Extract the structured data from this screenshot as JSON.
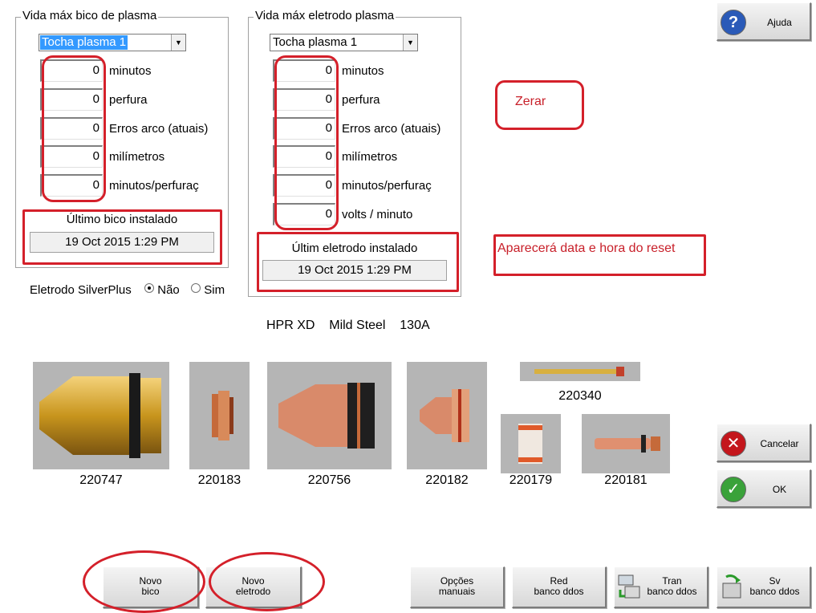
{
  "nozzle_panel": {
    "title": "Vida máx bico de plasma",
    "torch_select": "Tocha plasma 1",
    "fields": [
      {
        "value": "0",
        "label": "minutos"
      },
      {
        "value": "0",
        "label": "perfura"
      },
      {
        "value": "0",
        "label": "Erros arco (atuais)"
      },
      {
        "value": "0",
        "label": "milímetros"
      },
      {
        "value": "0",
        "label": "minutos/perfuraç"
      }
    ],
    "last_installed_label": "Último bico instalado",
    "last_installed_date": "19 Oct 2015  1:29 PM"
  },
  "electrode_panel": {
    "title": "Vida máx eletrodo plasma",
    "torch_select": "Tocha plasma 1",
    "fields": [
      {
        "value": "0",
        "label": "minutos"
      },
      {
        "value": "0",
        "label": "perfura"
      },
      {
        "value": "0",
        "label": "Erros arco (atuais)"
      },
      {
        "value": "0",
        "label": "milímetros"
      },
      {
        "value": "0",
        "label": "minutos/perfuraç"
      },
      {
        "value": "0",
        "label": "volts / minuto"
      }
    ],
    "last_installed_label": "Últim eletrodo instalado",
    "last_installed_date": "19 Oct 2015  1:29 PM"
  },
  "silverplus": {
    "label": "Eletrodo SilverPlus",
    "option_no": "Não",
    "option_yes": "Sim",
    "selected": "Não"
  },
  "annotations": {
    "reset": "Zerar",
    "reset_date": "Aparecerá data e hora do reset",
    "color": "#d4202a"
  },
  "process_info": "HPR XD    Mild Steel    130A",
  "parts": [
    {
      "id": "220747",
      "icon": "shield-cap"
    },
    {
      "id": "220183",
      "icon": "shield"
    },
    {
      "id": "220756",
      "icon": "retaining-cap"
    },
    {
      "id": "220182",
      "icon": "nozzle"
    },
    {
      "id": "220340",
      "icon": "water-tube"
    },
    {
      "id": "220179",
      "icon": "swirl-ring"
    },
    {
      "id": "220181",
      "icon": "electrode"
    }
  ],
  "buttons": {
    "help": "Ajuda",
    "cancel": "Cancelar",
    "ok": "OK",
    "new_nozzle_l1": "Novo",
    "new_nozzle_l2": "bico",
    "new_electrode_l1": "Novo",
    "new_electrode_l2": "eletrodo",
    "manual_l1": "Opções",
    "manual_l2": "manuais",
    "red_l1": "Red",
    "red_l2": "banco ddos",
    "tran_l1": "Tran",
    "tran_l2": "banco ddos",
    "sv_l1": "Sv",
    "sv_l2": "banco ddos"
  }
}
